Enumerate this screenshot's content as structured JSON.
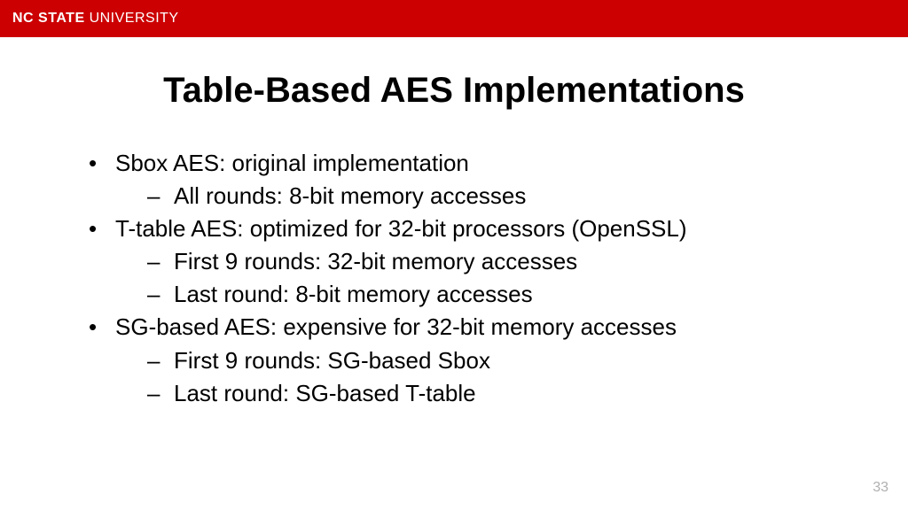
{
  "header": {
    "brand_bold": "NC STATE",
    "brand_light": " UNIVERSITY"
  },
  "slide": {
    "title": "Table-Based AES Implementations",
    "bullets": [
      {
        "text": "Sbox AES: original implementation",
        "sub": [
          "All rounds: 8-bit memory accesses"
        ]
      },
      {
        "text": "T-table AES: optimized for 32-bit processors (OpenSSL)",
        "sub": [
          "First 9 rounds: 32-bit memory accesses",
          "Last round: 8-bit memory accesses"
        ]
      },
      {
        "text": "SG-based AES: expensive for 32-bit memory accesses",
        "sub": [
          "First 9 rounds: SG-based Sbox",
          "Last round: SG-based T-table"
        ]
      }
    ],
    "page_number": "33"
  }
}
